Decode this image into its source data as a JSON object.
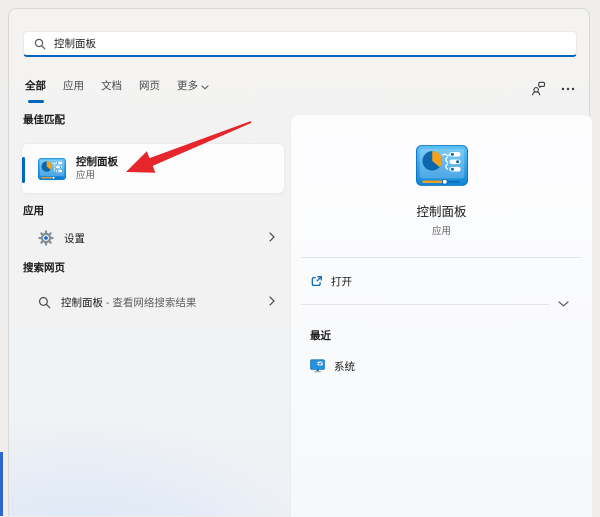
{
  "colors": {
    "accent": "#0067c0",
    "arrow": "#e5262c"
  },
  "search": {
    "value": "控制面板"
  },
  "tabs": {
    "items": [
      {
        "label": "全部"
      },
      {
        "label": "应用"
      },
      {
        "label": "文档"
      },
      {
        "label": "网页"
      },
      {
        "label": "更多"
      }
    ]
  },
  "left_panel": {
    "best_match_header": "最佳匹配",
    "best_match": {
      "title": "控制面板",
      "subtitle": "应用"
    },
    "apps_header": "应用",
    "settings_label": "设置",
    "web_header": "搜索网页",
    "web_result": {
      "label": "控制面板",
      "suffix": " - 查看网络搜索结果"
    }
  },
  "right_panel": {
    "title": "控制面板",
    "subtitle": "应用",
    "open_label": "打开",
    "recent_header": "最近",
    "recent_items": [
      {
        "label": "系统"
      }
    ]
  }
}
